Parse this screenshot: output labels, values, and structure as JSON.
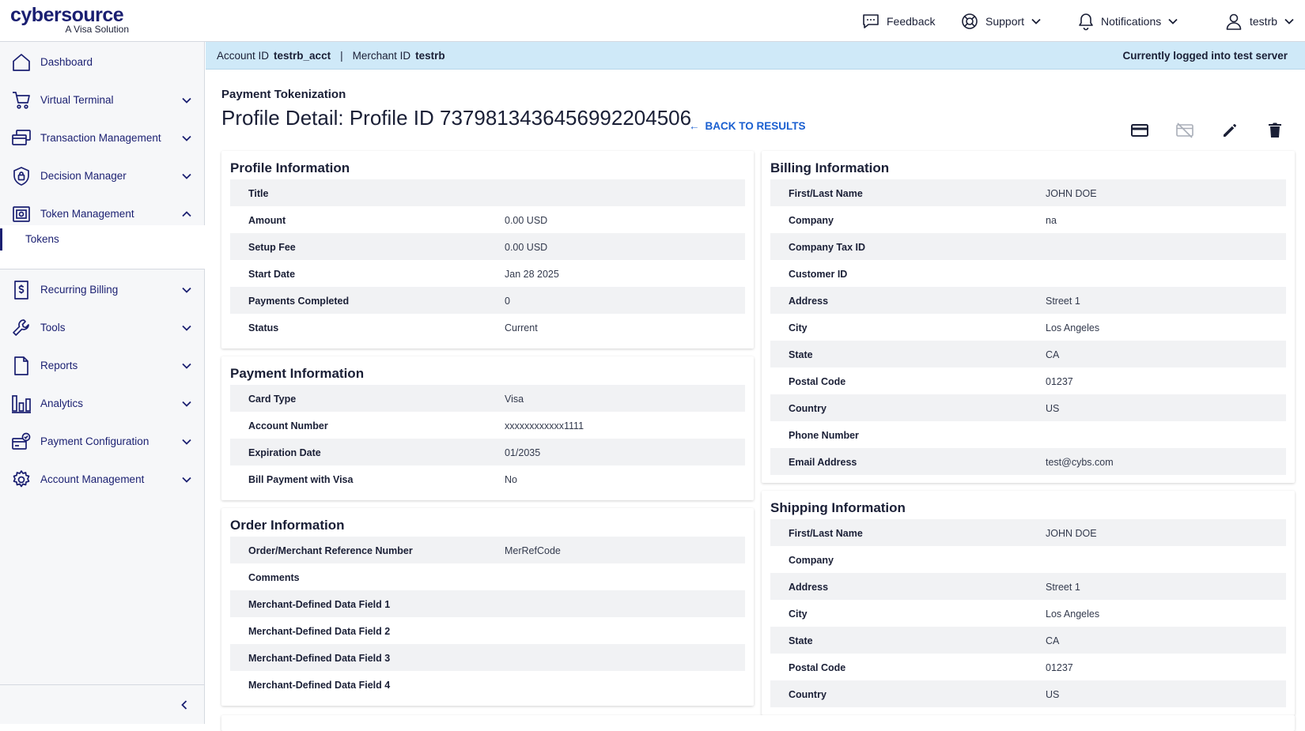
{
  "header": {
    "logo_main": "cybersource",
    "logo_sub": "A Visa Solution",
    "feedback": "Feedback",
    "support": "Support",
    "notifications": "Notifications",
    "user": "testrb"
  },
  "sidebar": {
    "items": [
      {
        "label": "Dashboard",
        "icon": "home-icon"
      },
      {
        "label": "Virtual Terminal",
        "icon": "cart-icon"
      },
      {
        "label": "Transaction Management",
        "icon": "cards-icon"
      },
      {
        "label": "Decision Manager",
        "icon": "shield-lock-icon"
      },
      {
        "label": "Token Management",
        "icon": "token-icon"
      },
      {
        "label": "Recurring Billing",
        "icon": "dollar-doc-icon"
      },
      {
        "label": "Tools",
        "icon": "wrench-icon"
      },
      {
        "label": "Reports",
        "icon": "document-icon"
      },
      {
        "label": "Analytics",
        "icon": "bar-chart-icon"
      },
      {
        "label": "Payment Configuration",
        "icon": "payment-config-icon"
      },
      {
        "label": "Account Management",
        "icon": "gear-icon"
      }
    ],
    "sub_items": [
      "Tokens"
    ]
  },
  "account_bar": {
    "account_id_label": "Account ID",
    "account_id": "testrb_acct",
    "separator": "|",
    "merchant_id_label": "Merchant ID",
    "merchant_id": "testrb",
    "server_status": "Currently logged into test server"
  },
  "page": {
    "breadcrumb": "Payment Tokenization",
    "title": "Profile Detail: Profile ID 7379813436456992204506",
    "back_link": "BACK TO RESULTS",
    "back_arrow": "←"
  },
  "profile_info": {
    "title": "Profile Information",
    "rows": [
      {
        "label": "Title",
        "value": ""
      },
      {
        "label": "Amount",
        "value": "0.00 USD"
      },
      {
        "label": "Setup Fee",
        "value": "0.00 USD"
      },
      {
        "label": "Start Date",
        "value": "Jan 28 2025"
      },
      {
        "label": "Payments Completed",
        "value": "0"
      },
      {
        "label": "Status",
        "value": "Current"
      }
    ]
  },
  "payment_info": {
    "title": "Payment Information",
    "rows": [
      {
        "label": "Card Type",
        "value": "Visa"
      },
      {
        "label": "Account Number",
        "value": "xxxxxxxxxxxx1111"
      },
      {
        "label": "Expiration Date",
        "value": "01/2035"
      },
      {
        "label": "Bill Payment with Visa",
        "value": "No"
      }
    ]
  },
  "order_info": {
    "title": "Order Information",
    "rows": [
      {
        "label": "Order/Merchant Reference Number",
        "value": "MerRefCode"
      },
      {
        "label": "Comments",
        "value": ""
      },
      {
        "label": "Merchant-Defined Data Field 1",
        "value": ""
      },
      {
        "label": "Merchant-Defined Data Field 2",
        "value": ""
      },
      {
        "label": "Merchant-Defined Data Field 3",
        "value": ""
      },
      {
        "label": "Merchant-Defined Data Field 4",
        "value": ""
      }
    ]
  },
  "billing_info": {
    "title": "Billing Information",
    "rows": [
      {
        "label": "First/Last Name",
        "value": "JOHN DOE"
      },
      {
        "label": "Company",
        "value": "na"
      },
      {
        "label": "Company Tax ID",
        "value": ""
      },
      {
        "label": "Customer ID",
        "value": ""
      },
      {
        "label": "Address",
        "value": "Street 1"
      },
      {
        "label": "City",
        "value": "Los Angeles"
      },
      {
        "label": "State",
        "value": "CA"
      },
      {
        "label": "Postal Code",
        "value": "01237"
      },
      {
        "label": "Country",
        "value": "US"
      },
      {
        "label": "Phone Number",
        "value": ""
      },
      {
        "label": "Email Address",
        "value": "test@cybs.com"
      }
    ]
  },
  "shipping_info": {
    "title": "Shipping Information",
    "rows": [
      {
        "label": "First/Last Name",
        "value": "JOHN DOE"
      },
      {
        "label": "Company",
        "value": ""
      },
      {
        "label": "Address",
        "value": "Street 1"
      },
      {
        "label": "City",
        "value": "Los Angeles"
      },
      {
        "label": "State",
        "value": "CA"
      },
      {
        "label": "Postal Code",
        "value": "01237"
      },
      {
        "label": "Country",
        "value": "US"
      }
    ]
  },
  "colors": {
    "brand": "#1a1f71",
    "link": "#1a5fd0",
    "account_bar": "#cfe9f8",
    "row_shade": "#f1f2f4"
  }
}
